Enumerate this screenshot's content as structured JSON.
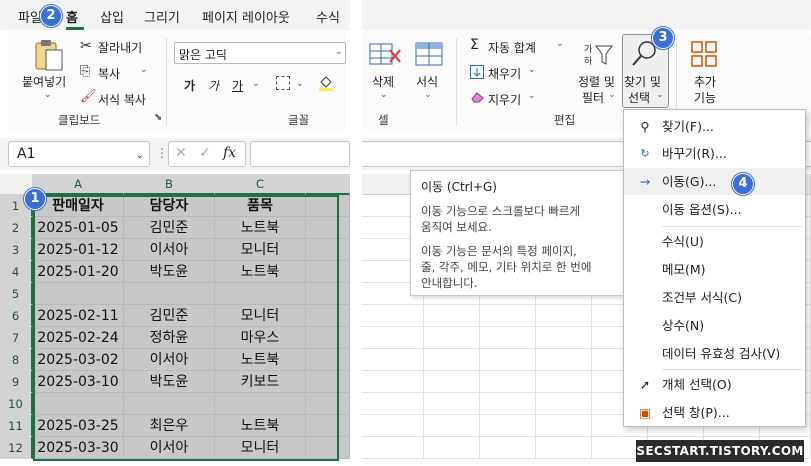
{
  "tabs": [
    {
      "label": "파일"
    },
    {
      "label": "홈"
    },
    {
      "label": "삽입"
    },
    {
      "label": "그리기"
    },
    {
      "label": "페이지 레이아웃"
    },
    {
      "label": "수식"
    }
  ],
  "ribbon": {
    "clipboard": {
      "paste": "붙여넣기",
      "cut": "잘라내기",
      "copy": "복사",
      "format_painter": "서식 복사",
      "group": "클립보드"
    },
    "font": {
      "font_name": "맑은 고딕",
      "bold": "가",
      "italic": "가",
      "underline": "가",
      "group": "글꼴"
    },
    "cells": {
      "delete": "삭제",
      "format": "서식",
      "group": "셀"
    },
    "editing": {
      "autosum": "자동 합계",
      "fill": "채우기",
      "clear": "지우기",
      "sort_filter_1": "정렬 및",
      "sort_filter_2": "필터",
      "find_select_1": "찾기 및",
      "find_select_2": "선택",
      "group": "편집"
    },
    "addins": {
      "label_1": "추가",
      "label_2": "기능"
    }
  },
  "formula_bar": {
    "name_box": "A1",
    "fx": "fx"
  },
  "grid": {
    "columns": [
      "A",
      "B",
      "C"
    ],
    "rows": [
      "1",
      "2",
      "3",
      "4",
      "5",
      "6",
      "7",
      "8",
      "9",
      "10",
      "11",
      "12"
    ],
    "data": [
      [
        "판매일자",
        "담당자",
        "품목"
      ],
      [
        "2025-01-05",
        "김민준",
        "노트북"
      ],
      [
        "2025-01-12",
        "이서아",
        "모니터"
      ],
      [
        "2025-01-20",
        "박도윤",
        "노트북"
      ],
      [
        "",
        "",
        ""
      ],
      [
        "2025-02-11",
        "김민준",
        "모니터"
      ],
      [
        "2025-02-24",
        "정하윤",
        "마우스"
      ],
      [
        "2025-03-02",
        "이서아",
        "노트북"
      ],
      [
        "2025-03-10",
        "박도윤",
        "키보드"
      ],
      [
        "",
        "",
        ""
      ],
      [
        "2025-03-25",
        "최은우",
        "노트북"
      ],
      [
        "2025-03-30",
        "이서아",
        "모니터"
      ]
    ]
  },
  "tooltip": {
    "title": "이동 (Ctrl+G)",
    "line1": "이동 기능으로 스크롤보다 빠르게",
    "line2": "움직여 보세요.",
    "line3": "이동 기능은 문서의 특정 페이지,",
    "line4": "줄, 각주, 메모, 기타 위치로 한 번에",
    "line5": "안내합니다."
  },
  "menu": {
    "items": [
      {
        "label": "찾기(F)..."
      },
      {
        "label": "바꾸기(R)..."
      },
      {
        "label": "이동(G)..."
      },
      {
        "label": "이동 옵션(S)..."
      },
      {
        "label": "수식(U)"
      },
      {
        "label": "메모(M)"
      },
      {
        "label": "조건부 서식(C)"
      },
      {
        "label": "상수(N)"
      },
      {
        "label": "데이터 유효성 검사(V)"
      },
      {
        "label": "개체 선택(O)"
      },
      {
        "label": "선택 창(P)..."
      }
    ]
  },
  "badges": [
    "1",
    "2",
    "3",
    "4"
  ],
  "watermark": "SECSTART.TISTORY.COM",
  "colors": {
    "accent": "#1e7145",
    "badge": "#3a6fd8",
    "selection": "#c8c8c8"
  }
}
